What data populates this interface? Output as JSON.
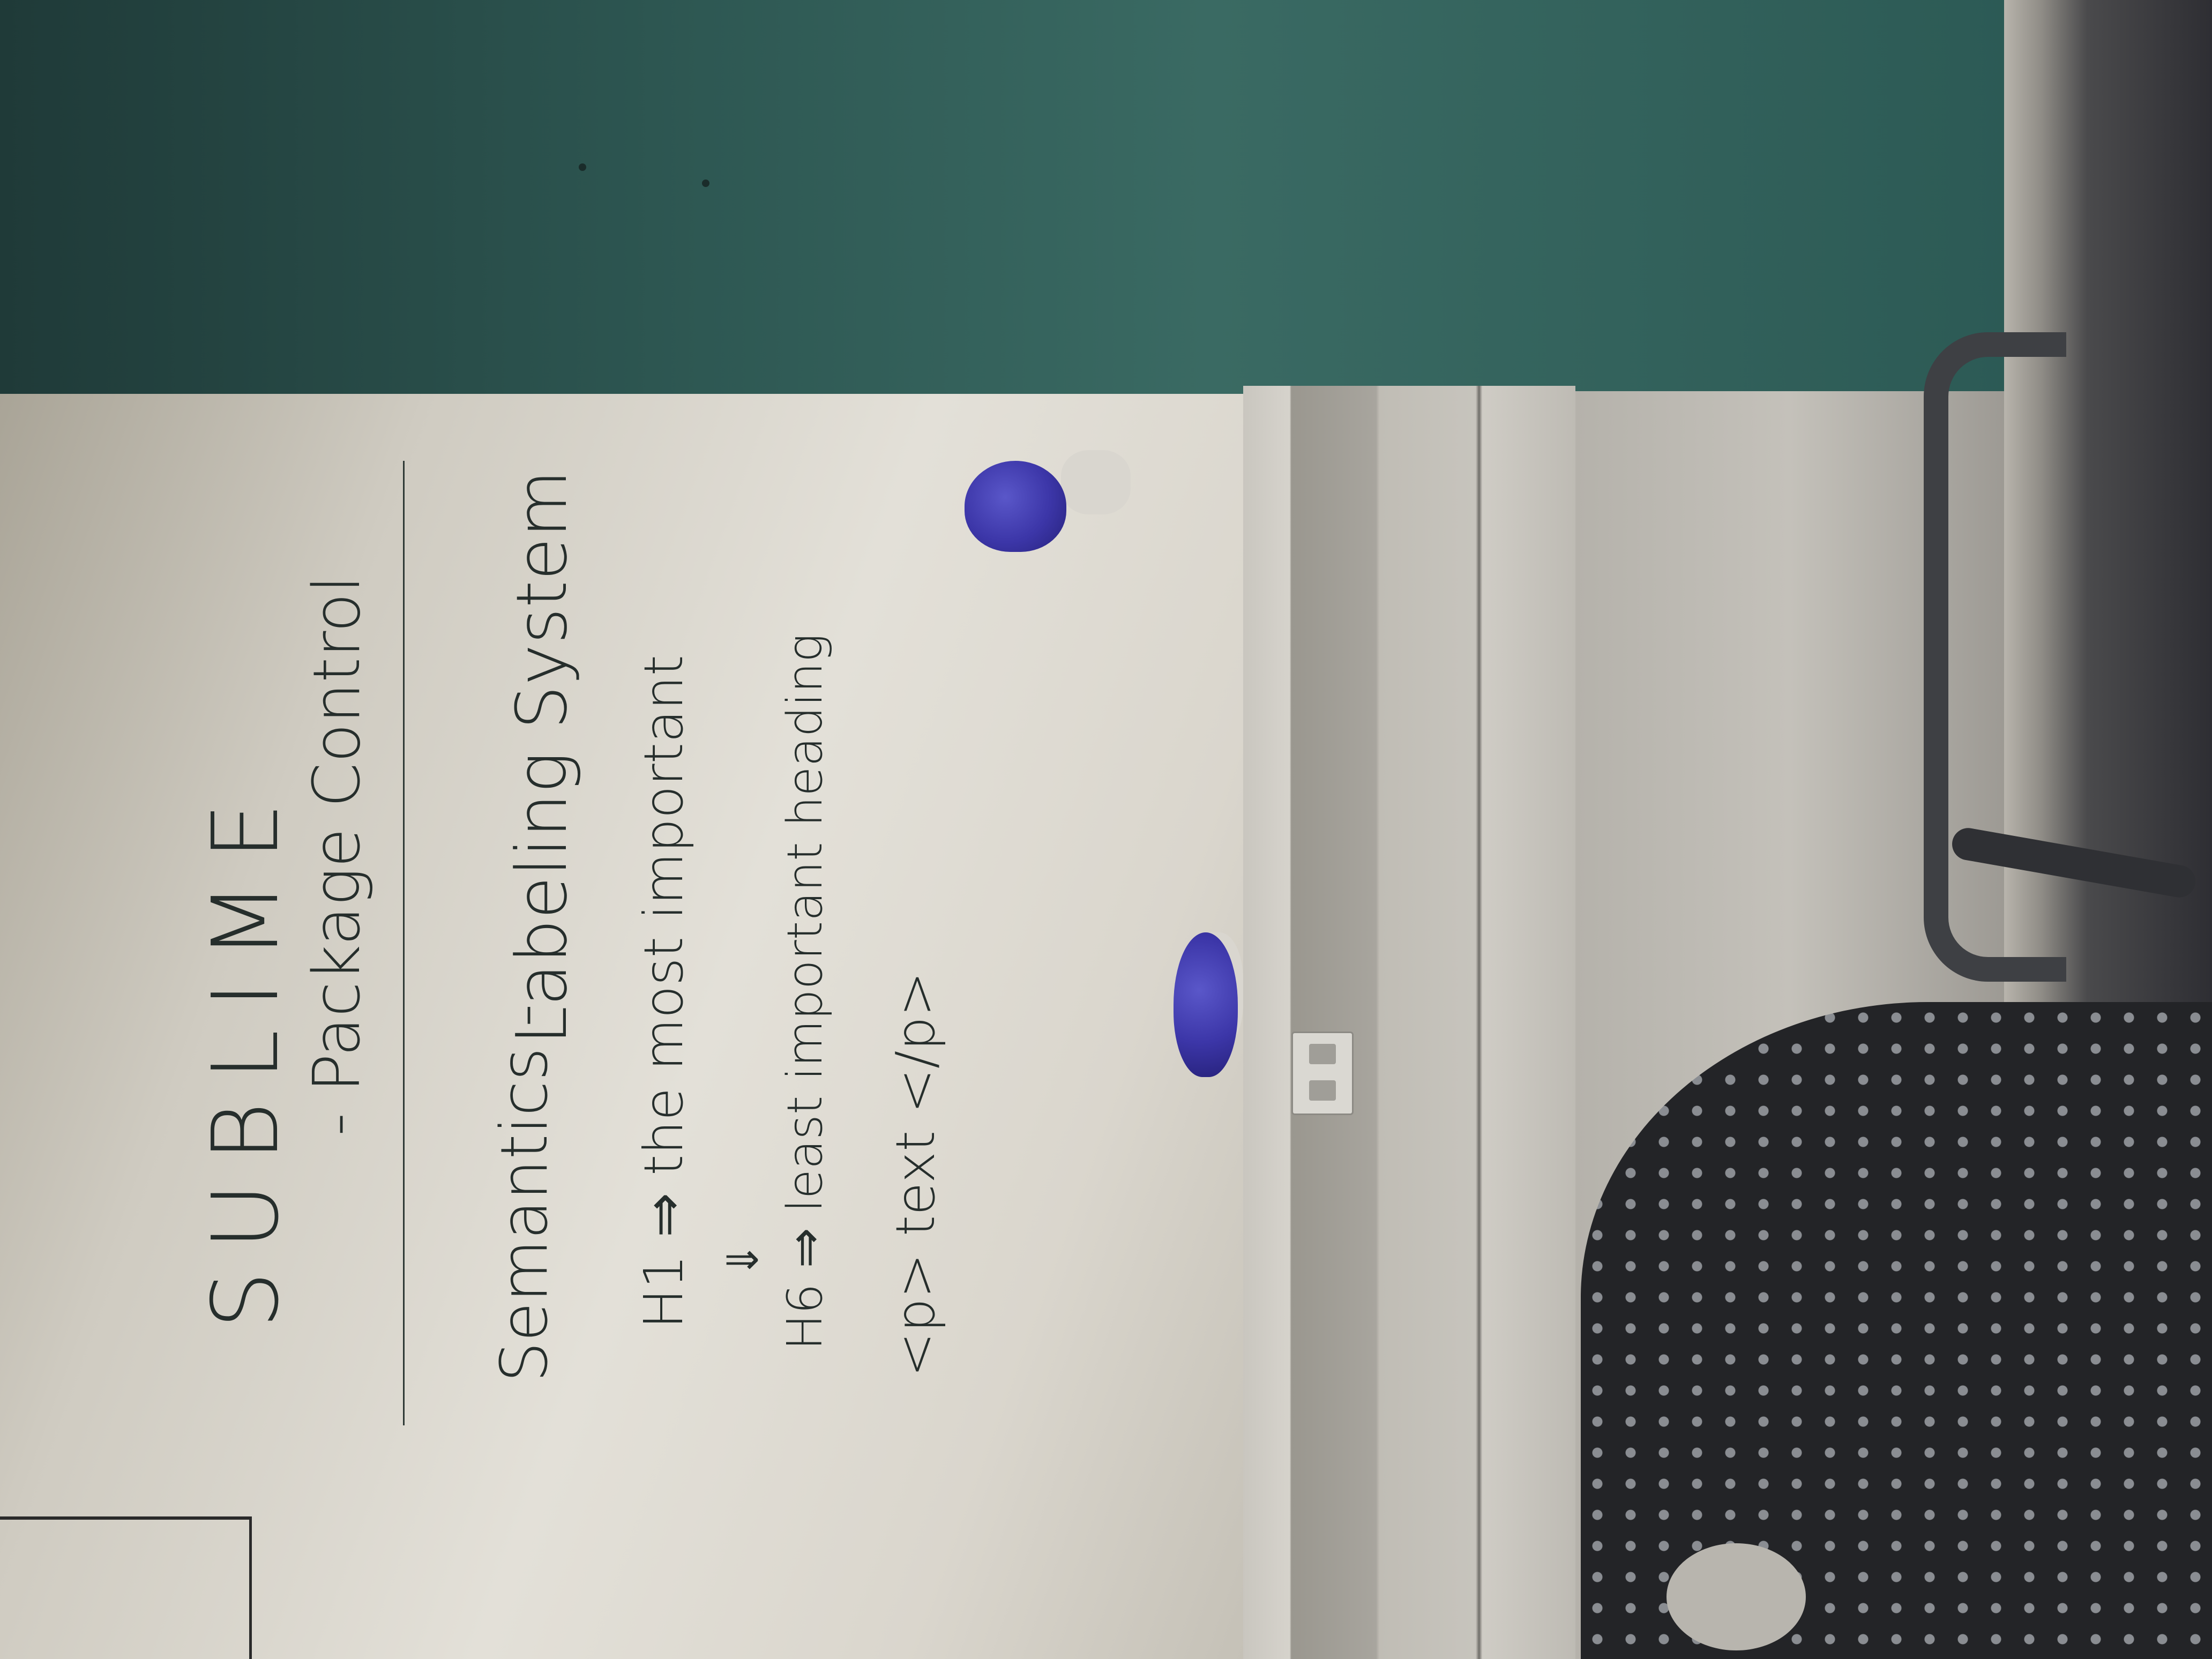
{
  "whiteboard": {
    "title": "SUBLIME",
    "lines": [
      "- Package Control",
      "Semantics -",
      "Labeling System",
      "H1 ⇒ the most important",
      "⇓",
      "H6 ⇒ least important heading",
      "<p> text </p>"
    ]
  },
  "colors": {
    "wall": "#2e5853",
    "board": "#e3e0d8",
    "ink": "#262e2c",
    "eraser": "#3c36a8",
    "chair": "#232427"
  }
}
